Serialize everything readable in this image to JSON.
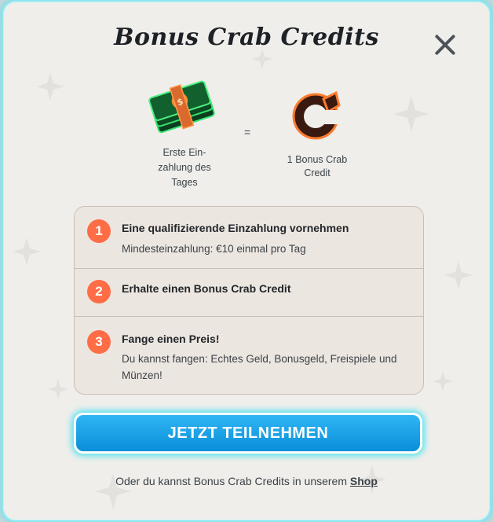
{
  "modal": {
    "title": "Bonus Crab Credits",
    "close_icon": "close-icon"
  },
  "exchange": {
    "cash_icon": "cash-stack-icon",
    "cash_label": "Erste Ein-zahlung des Tages",
    "equals": "=",
    "credit_icon": "crab-credit-coin-icon",
    "credit_label": "1 Bonus Crab Credit"
  },
  "steps": [
    {
      "number": "1",
      "title": "Eine qualifizierende Einzahlung vornehmen",
      "description": "Mindesteinzahlung: €10 einmal pro Tag"
    },
    {
      "number": "2",
      "title": "Erhalte einen Bonus Crab Credit",
      "description": ""
    },
    {
      "number": "3",
      "title": "Fange einen Preis!",
      "description": "Du kannst fangen: Echtes Geld, Bonusgeld, Freispiele und Münzen!"
    }
  ],
  "cta": {
    "label": "JETZT TEILNEHMEN"
  },
  "footer": {
    "text": "Oder du kannst Bonus Crab Credits in unserem",
    "link": "Shop"
  },
  "colors": {
    "accent_orange": "#ff6d46",
    "button_blue": "#0a8ed8",
    "glow_cyan": "#6fe0ea"
  }
}
